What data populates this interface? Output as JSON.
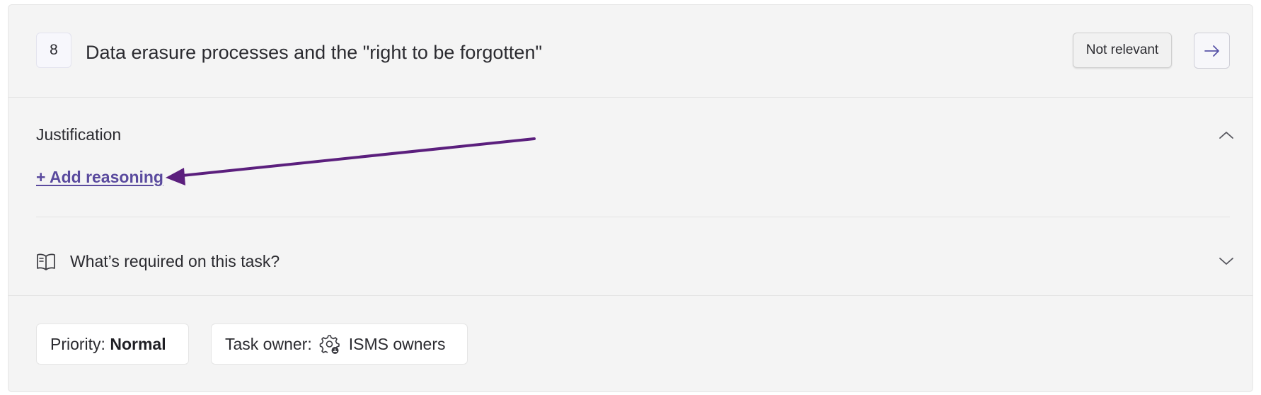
{
  "task": {
    "number": "8",
    "title": "Data erasure processes and the \"right to be forgotten\"",
    "status_button": "Not relevant",
    "next_icon": "arrow-right-icon"
  },
  "justification": {
    "label": "Justification",
    "toggle_icon": "chevron-up-icon",
    "add_link": "+ Add reasoning"
  },
  "requirements": {
    "icon": "book-open-icon",
    "label": "What’s required on this task?",
    "toggle_icon": "chevron-down-icon"
  },
  "footer": {
    "priority_label": "Priority:",
    "priority_value": "Normal",
    "owner_label": "Task owner:",
    "owner_icon": "users-gear-icon",
    "owner_value": "ISMS owners"
  },
  "colors": {
    "card_bg": "#f4f4f4",
    "link": "#5a4a9e",
    "annotation_arrow": "#5b1f7d",
    "accent": "#5a55a8"
  }
}
